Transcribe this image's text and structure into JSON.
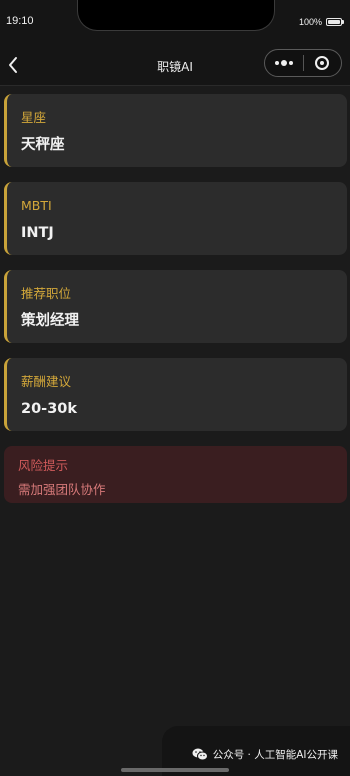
{
  "status_bar": {
    "time": "19:10",
    "battery_text": "100%"
  },
  "nav": {
    "title": "职镜AI",
    "icons": [
      "back-arrow-icon",
      "more-dots-icon",
      "close-circle-icon"
    ]
  },
  "cards": [
    {
      "label": "星座",
      "value": "天秤座"
    },
    {
      "label": "MBTI",
      "value": "INTJ"
    },
    {
      "label": "推荐职位",
      "value": "策划经理"
    },
    {
      "label": "薪酬建议",
      "value": "20-30k"
    }
  ],
  "risk": {
    "label": "风险提示",
    "value": "需加强团队协作"
  },
  "watermark": {
    "text": "公众号 · 人工智能AI公开课"
  },
  "colors": {
    "background": "#1b1b1b",
    "card_bg": "#2c2c2c",
    "accent_gold": "#d4a83a",
    "risk_bg": "#3a1e20",
    "risk_text": "#cf5a5a"
  }
}
